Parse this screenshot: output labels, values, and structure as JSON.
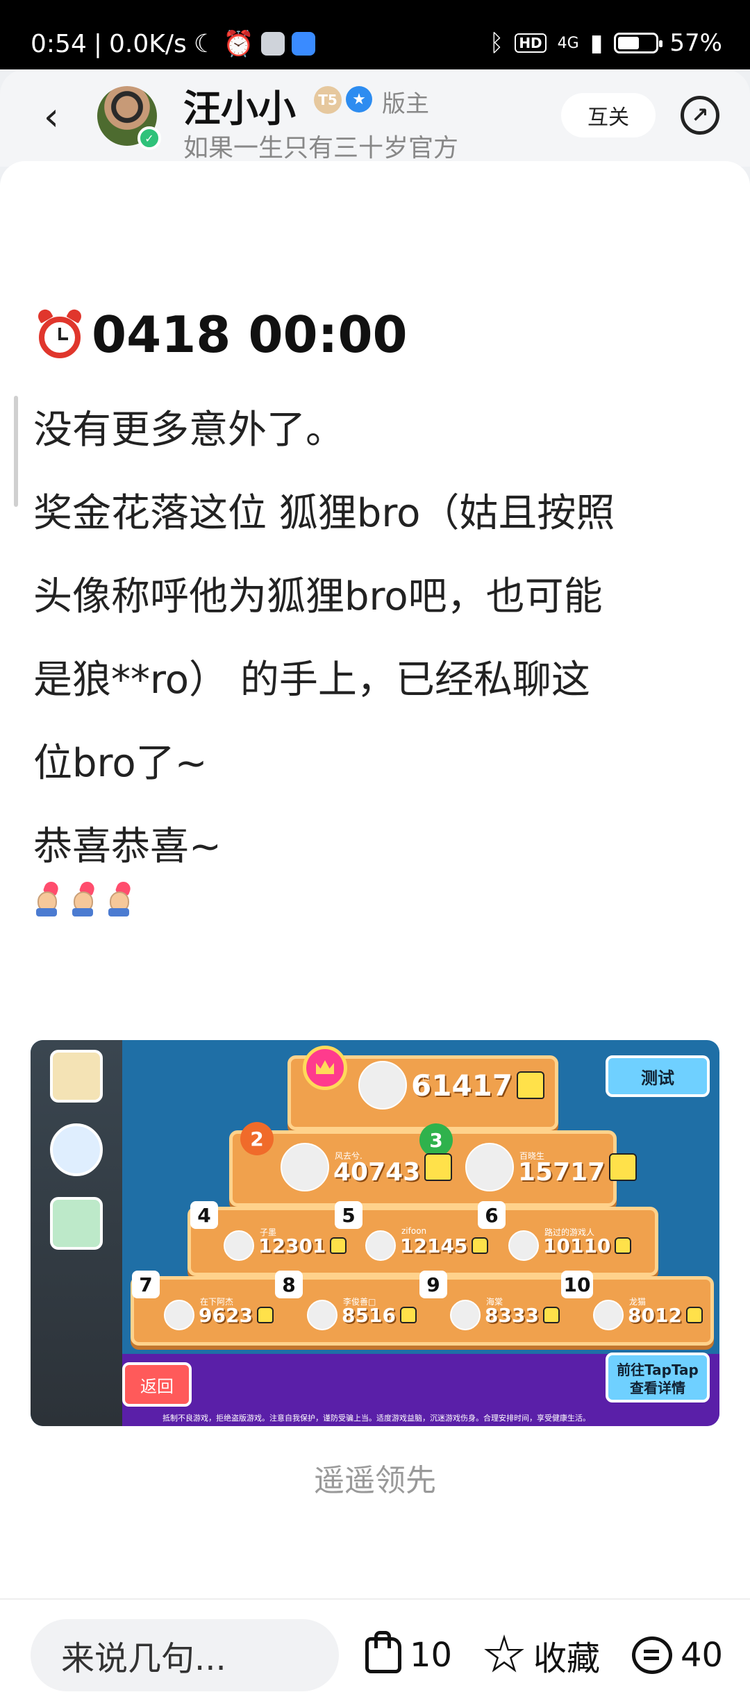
{
  "status_bar": {
    "time": "0:54",
    "network_speed": "0.0K/s",
    "network_type": "4G",
    "hd_label": "HD",
    "battery": "57%",
    "battery_level": 0.57
  },
  "header": {
    "user_name": "汪小小",
    "level_badge": "T5",
    "role": "版主",
    "subtitle": "如果一生只有三十岁官方",
    "follow_label": "互关"
  },
  "post": {
    "title": "0418 00:00",
    "lines": [
      "没有更多意外了。",
      "奖金花落这位 狐狸bro（姑且按照",
      "头像称呼他为狐狸bro吧，也可能",
      "是狼**ro） 的手上，已经私聊这",
      "位bro了~",
      "恭喜恭喜~"
    ],
    "image_caption": "遥遥领先"
  },
  "game": {
    "test_button": "测试",
    "back_button": "返回",
    "taptap_line1": "前往TapTap",
    "taptap_line2": "查看详情",
    "notice": "抵制不良游戏，拒绝盗版游戏。注意自我保护，谨防受骗上当。适度游戏益脑，沉迷游戏伤身。合理安排时间，享受健康生活。",
    "ranks": [
      {
        "rank": "1",
        "name": "□",
        "score": "61417"
      },
      {
        "rank": "2",
        "name": "风去兮.",
        "score": "40743"
      },
      {
        "rank": "3",
        "name": "百晓生",
        "score": "15717"
      },
      {
        "rank": "4",
        "name": "子墨",
        "score": "12301"
      },
      {
        "rank": "5",
        "name": "zifoon",
        "score": "12145"
      },
      {
        "rank": "6",
        "name": "路过的游戏人",
        "score": "10110"
      },
      {
        "rank": "7",
        "name": "在下阿杰",
        "score": "9623"
      },
      {
        "rank": "8",
        "name": "李俊善□",
        "score": "8516"
      },
      {
        "rank": "9",
        "name": "海棠",
        "score": "8333"
      },
      {
        "rank": "10",
        "name": "龙猫",
        "score": "8012"
      }
    ]
  },
  "bottom_bar": {
    "comment_placeholder": "来说几句...",
    "like_count": "10",
    "favorite_label": "收藏",
    "comment_count": "40"
  },
  "colors": {
    "accent_blue": "#2d8cf0",
    "game_bg": "#1f6fa6",
    "tier_orange": "#f0a14d"
  }
}
